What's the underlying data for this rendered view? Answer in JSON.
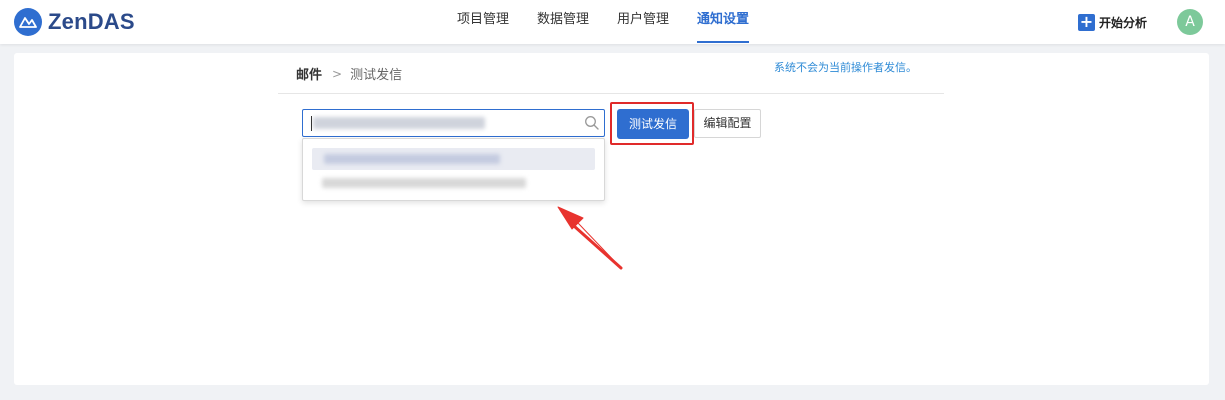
{
  "app": {
    "logo_text": "ZenDAS",
    "accent_color": "#2f6ed0"
  },
  "nav": {
    "items": [
      {
        "label": "项目管理",
        "active": false
      },
      {
        "label": "数据管理",
        "active": false
      },
      {
        "label": "用户管理",
        "active": false
      },
      {
        "label": "通知设置",
        "active": true
      }
    ]
  },
  "header": {
    "start_analysis_label": "开始分析",
    "avatar_initial": "A"
  },
  "breadcrumb": {
    "root": "邮件",
    "separator": ">",
    "current": "测试发信"
  },
  "notice_text": "系统不会为当前操作者发信。",
  "search": {
    "icon": "search-icon"
  },
  "buttons": {
    "test_send_label": "测试发信",
    "edit_config_label": "编辑配置"
  },
  "annotation": {
    "highlight_color": "#e02a2a"
  }
}
